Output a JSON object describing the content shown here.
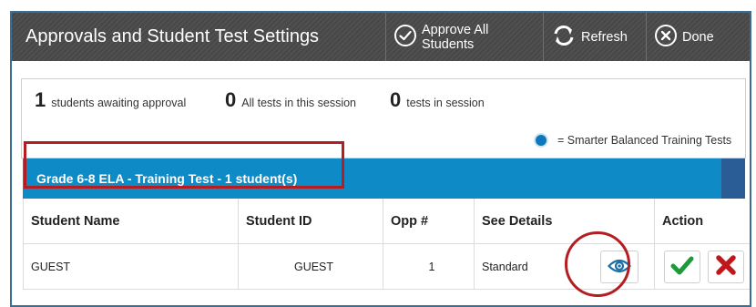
{
  "header": {
    "title": "Approvals and Student Test Settings",
    "buttons": {
      "approve_all": "Approve All Students",
      "refresh": "Refresh",
      "done": "Done"
    }
  },
  "summary": {
    "awaiting": {
      "count": "1",
      "label": "students awaiting approval"
    },
    "all_tests": {
      "count": "0",
      "label": "All tests in this session"
    },
    "tests_in_session": {
      "count": "0",
      "label": "tests in session"
    },
    "legend": "= Smarter Balanced Training Tests"
  },
  "group": {
    "label": "Grade 6-8 ELA - Training Test - 1 student(s)"
  },
  "table": {
    "headers": [
      "Student Name",
      "Student ID",
      "Opp #",
      "See Details",
      "Action"
    ],
    "rows": [
      {
        "name": "GUEST",
        "id": "GUEST",
        "opp": "1",
        "details": "Standard"
      }
    ]
  },
  "colors": {
    "title_bar": "#4a4a4a",
    "group_bar": "#0e8bc6",
    "approve_green": "#1e9a3c",
    "deny_red": "#c0171c",
    "eye_blue": "#1a6fa8",
    "highlight_red": "#b41d22"
  },
  "icons": {
    "approve_all": "check-circle-icon",
    "refresh": "refresh-icon",
    "done": "close-circle-icon",
    "legend": "dot-icon",
    "see_details": "eye-icon",
    "approve": "checkmark-icon",
    "deny": "x-icon"
  }
}
